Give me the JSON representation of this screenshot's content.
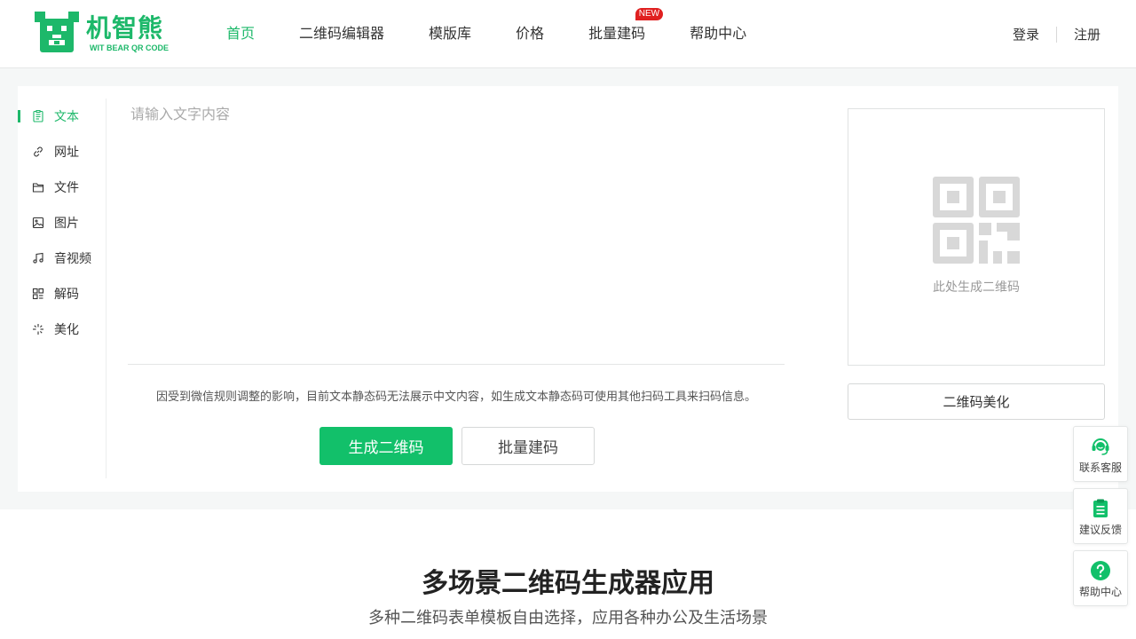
{
  "header": {
    "logo": {
      "name": "机智熊",
      "sub": "WIT BEAR QR CODE"
    },
    "nav": [
      {
        "label": "首页",
        "active": true
      },
      {
        "label": "二维码编辑器",
        "active": false
      },
      {
        "label": "模版库",
        "active": false
      },
      {
        "label": "价格",
        "active": false
      },
      {
        "label": "批量建码",
        "active": false,
        "badge": "NEW"
      },
      {
        "label": "帮助中心",
        "active": false
      }
    ],
    "login": "登录",
    "register": "注册"
  },
  "sidebar": {
    "items": [
      {
        "label": "文本",
        "icon": "document-icon",
        "active": true
      },
      {
        "label": "网址",
        "icon": "link-icon",
        "active": false
      },
      {
        "label": "文件",
        "icon": "folder-icon",
        "active": false
      },
      {
        "label": "图片",
        "icon": "image-icon",
        "active": false
      },
      {
        "label": "音视频",
        "icon": "music-icon",
        "active": false
      },
      {
        "label": "解码",
        "icon": "qr-scan-icon",
        "active": false
      },
      {
        "label": "美化",
        "icon": "sparkle-icon",
        "active": false
      }
    ]
  },
  "editor": {
    "placeholder": "请输入文字内容",
    "value": "",
    "notice": "因受到微信规则调整的影响，目前文本静态码无法展示中文内容，如生成文本静态码可使用其他扫码工具来扫码信息。",
    "generate_label": "生成二维码",
    "batch_label": "批量建码"
  },
  "preview": {
    "hint": "此处生成二维码",
    "beautify_label": "二维码美化"
  },
  "section": {
    "title": "多场景二维码生成器应用",
    "subtitle": "多种二维码表单模板自由选择，应用各种办公及生活场景"
  },
  "float_tools": [
    {
      "label": "联系客服",
      "icon": "customer-service-icon"
    },
    {
      "label": "建议反馈",
      "icon": "clipboard-icon"
    },
    {
      "label": "帮助中心",
      "icon": "question-icon"
    }
  ],
  "colors": {
    "accent": "#1db86a",
    "button": "#12c06a",
    "badge": "#e02020"
  }
}
